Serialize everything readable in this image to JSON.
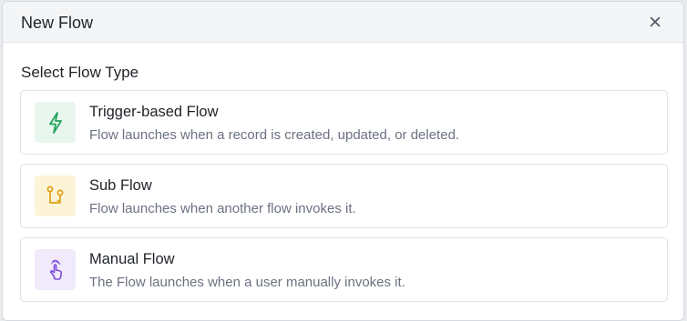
{
  "dialog": {
    "title": "New Flow",
    "close_icon": "close-icon"
  },
  "section": {
    "title": "Select Flow Type"
  },
  "options": [
    {
      "title": "Trigger-based Flow",
      "description": "Flow launches when a record is created, updated, or deleted.",
      "icon": "lightning-bolt-icon",
      "icon_color": "#22a55b",
      "icon_bg": "#e8f6ee"
    },
    {
      "title": "Sub Flow",
      "description": "Flow launches when another flow invokes it.",
      "icon": "git-branch-icon",
      "icon_color": "#e0a014",
      "icon_bg": "#fdf4d8"
    },
    {
      "title": "Manual Flow",
      "description": "The Flow launches when a user manually invokes it.",
      "icon": "hand-tap-icon",
      "icon_color": "#7c4ddc",
      "icon_bg": "#f0eafb"
    }
  ]
}
